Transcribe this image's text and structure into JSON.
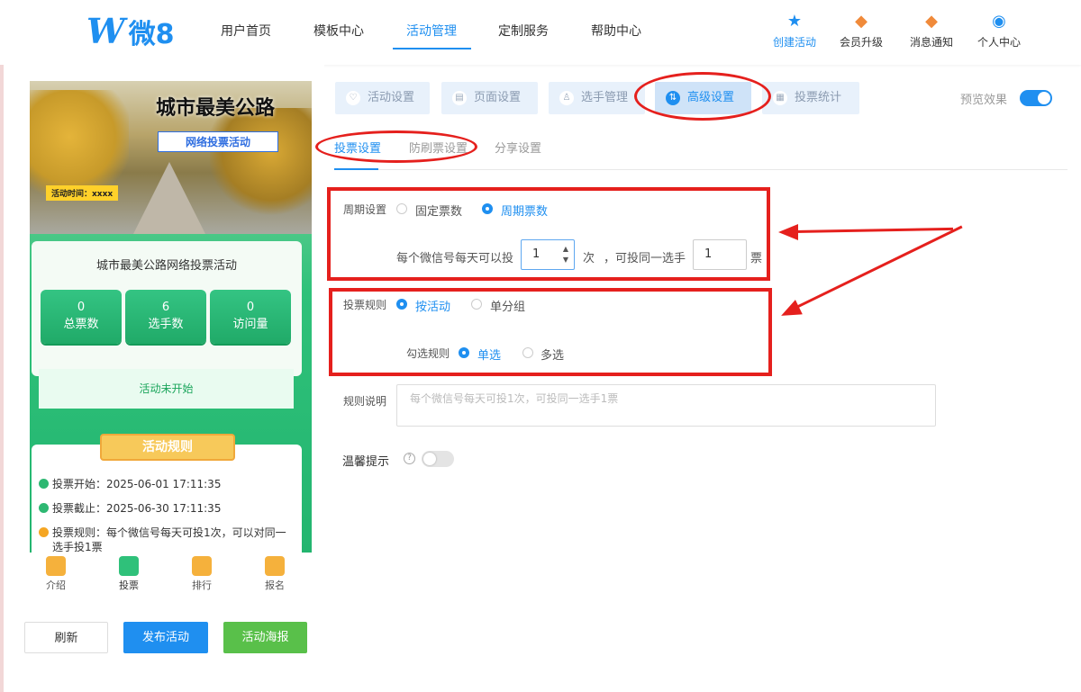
{
  "brand": {
    "logo_w": "W",
    "logo_text": "微8"
  },
  "nav": [
    "用户首页",
    "模板中心",
    "活动管理",
    "定制服务",
    "帮助中心"
  ],
  "tools": [
    {
      "label": "创建活动",
      "icon": "star-icon"
    },
    {
      "label": "会员升级",
      "icon": "crown-icon"
    },
    {
      "label": "消息通知",
      "icon": "bell-icon"
    },
    {
      "label": "个人中心",
      "icon": "user-icon"
    }
  ],
  "preview_banner": {
    "title": "城市最美公路",
    "subtitle": "网络投票活动",
    "time": "活动时间：xxxx"
  },
  "preview_stats": {
    "activity_name": "城市最美公路网络投票活动",
    "items": [
      {
        "value": "0",
        "label": "总票数"
      },
      {
        "value": "6",
        "label": "选手数"
      },
      {
        "value": "0",
        "label": "访问量"
      }
    ],
    "status": "活动未开始"
  },
  "preview_rules": {
    "heading": "活动规则",
    "items": [
      "投票开始：2025-06-01 17:11:35",
      "投票截止：2025-06-30 17:11:35",
      "投票规则：每个微信号每天可投1次，可以对同一选手投1票"
    ]
  },
  "preview_tabbar": [
    "介绍",
    "投票",
    "排行",
    "报名"
  ],
  "actions": {
    "refresh": "刷新",
    "publish": "发布活动",
    "poster": "活动海报"
  },
  "settings_tabs": [
    {
      "label": "活动设置",
      "icon": "heart-icon"
    },
    {
      "label": "页面设置",
      "icon": "page-icon"
    },
    {
      "label": "选手管理",
      "icon": "person-icon"
    },
    {
      "label": "高级设置",
      "icon": "sliders-icon"
    },
    {
      "label": "投票统计",
      "icon": "chart-icon"
    }
  ],
  "preview_toggle": {
    "label": "预览效果",
    "on": true
  },
  "sub_tabs": [
    "投票设置",
    "防刷票设置",
    "分享设置"
  ],
  "form": {
    "cycle_label": "周期设置",
    "cycle_options": [
      "固定票数",
      "周期票数"
    ],
    "cycle_selected": "周期票数",
    "daily_prefix": "每个微信号每天可以投",
    "daily_value": "1",
    "daily_unit": "次",
    "same_prefix": "，可投同一选手",
    "same_value": "1",
    "same_unit": "票",
    "rule_label": "投票规则",
    "rule_options": [
      "按活动",
      "单分组"
    ],
    "rule_selected": "按活动",
    "check_label": "勾选规则",
    "check_options": [
      "单选",
      "多选"
    ],
    "check_selected": "单选",
    "desc_label": "规则说明",
    "desc_placeholder": "每个微信号每天可投1次，可投同一选手1票",
    "tip_label": "温馨提示",
    "tip_help": "?",
    "tip_on": false
  },
  "colors": {
    "accent": "#1f8ff0",
    "annotation": "#e5201d",
    "green": "#2fc17a"
  }
}
